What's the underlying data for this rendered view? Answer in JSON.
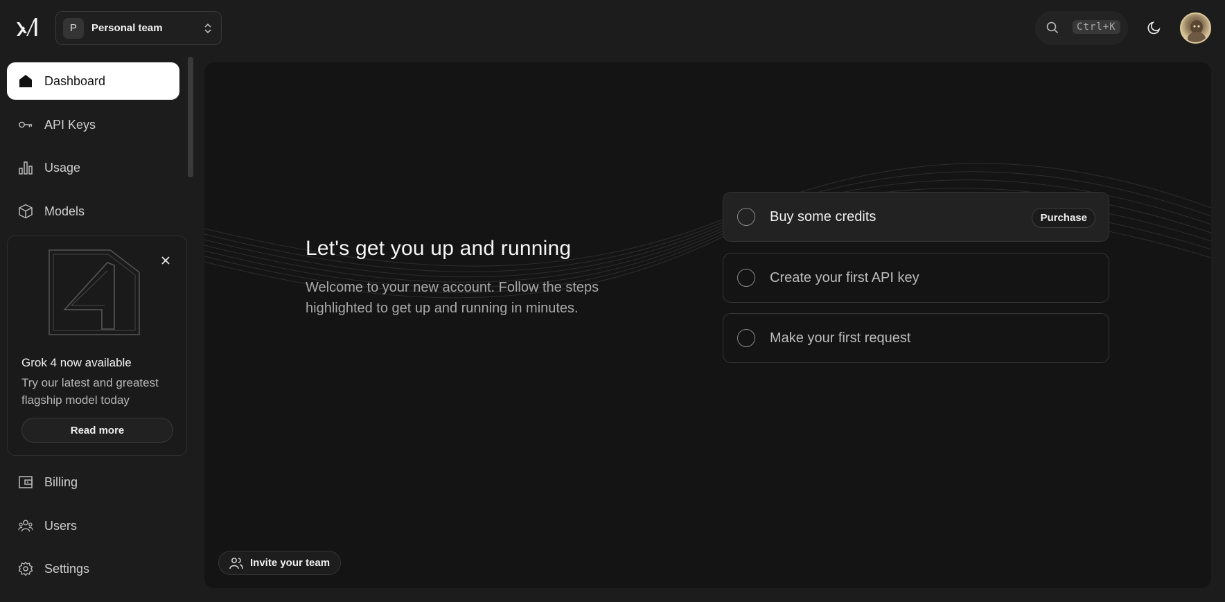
{
  "header": {
    "team": {
      "initial": "P",
      "name": "Personal team"
    },
    "search": {
      "shortcut": "Ctrl+K",
      "icon": "search-icon"
    },
    "theme_icon": "moon-icon",
    "avatar_icon": "user-avatar"
  },
  "sidebar": {
    "items": [
      {
        "label": "Dashboard",
        "icon": "home-icon",
        "active": true
      },
      {
        "label": "API Keys",
        "icon": "key-icon"
      },
      {
        "label": "Usage",
        "icon": "bar-chart-icon"
      },
      {
        "label": "Models",
        "icon": "cube-icon"
      },
      {
        "label": "Billing",
        "icon": "wallet-icon"
      },
      {
        "label": "Users",
        "icon": "users-icon"
      },
      {
        "label": "Settings",
        "icon": "gear-icon"
      }
    ],
    "promo": {
      "title": "Grok 4 now available",
      "text": "Try our latest and greatest flagship model today",
      "button": "Read more"
    }
  },
  "main": {
    "title": "Let's get you up and running",
    "subtitle": "Welcome to your new account. Follow the steps highlighted to get up and running in minutes.",
    "steps": [
      {
        "label": "Buy some credits",
        "action": "Purchase",
        "highlighted": true
      },
      {
        "label": "Create your first API key"
      },
      {
        "label": "Make your first request"
      }
    ],
    "invite_label": "Invite your team"
  },
  "colors": {
    "background": "#1c1c1c",
    "panel": "#141414",
    "active_nav": "#ffffff"
  }
}
